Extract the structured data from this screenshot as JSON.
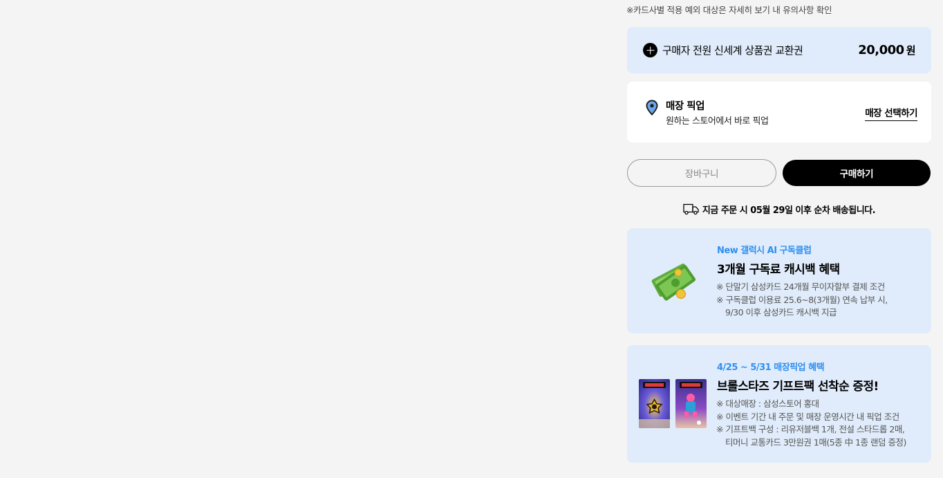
{
  "notice": "※카드사별 적용 예외 대상은 자세히 보기 내 유의사항 확인",
  "gift_voucher": {
    "label": "구매자 전원 신세계 상품권 교환권",
    "amount": "20,000",
    "unit": "원"
  },
  "store_pickup": {
    "title": "매장 픽업",
    "subtitle": "원하는 스토어에서 바로 픽업",
    "link": "매장 선택하기"
  },
  "buttons": {
    "cart": "장바구니",
    "buy": "구매하기"
  },
  "delivery_notice": "지금 주문 시  05월 29일 이후 순차 배송됩니다.",
  "promos": [
    {
      "eyebrow": "New 갤럭시 AI 구독클럽",
      "title": "3개월 구독료 캐시백 혜택",
      "lines": [
        "※ 단말기 삼성카드 24개월 무이자할부 결제 조건",
        "※ 구독클럽 이용료 25.6~8(3개월) 연속 납부 시,",
        "9/30 이후 삼성카드 캐시백 지급"
      ],
      "icon": "money-icon"
    },
    {
      "eyebrow": "4/25 ~ 5/31 매장픽업 혜택",
      "title": "브롤스타즈 기프트팩 선착순 증정!",
      "lines": [
        "※ 대상매장 : 삼성스토어 홍대",
        "※ 이벤트 기간 내 주문 및 매장 운영시간 내 픽업 조건",
        "※ 기프트백 구성 : 리유저블백 1개, 전설 스타드롭 2매,",
        "티머니 교통카드 3만원권 1매(5종 中 1종 랜덤 증정)"
      ],
      "icon": "brawl-stars-card-icon"
    }
  ],
  "colors": {
    "accent_blue": "#2e8ff0",
    "panel_blue": "#e0ecfb",
    "background": "#f4f4f4"
  }
}
